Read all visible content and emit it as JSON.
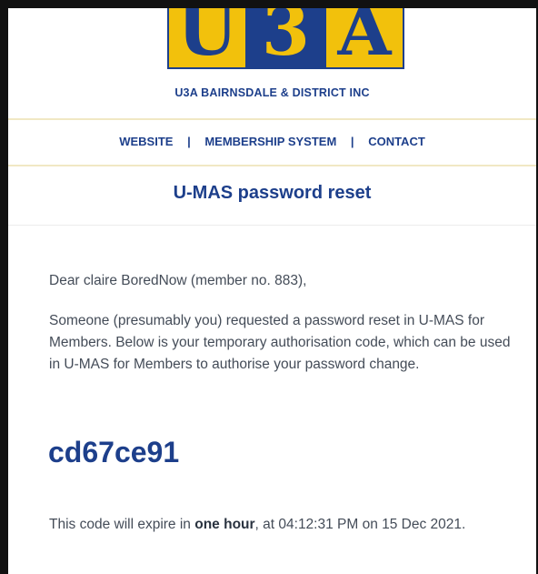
{
  "logo": {
    "letters": [
      "U",
      "3",
      "A"
    ],
    "colors": {
      "yellow": "#f2c10c",
      "navy": "#1d3f8b"
    }
  },
  "header": {
    "org_name": "U3A BAIRNSDALE & DISTRICT INC",
    "nav": {
      "website": "WEBSITE",
      "separator": "|",
      "membership_system": "MEMBERSHIP SYSTEM",
      "contact": "CONTACT"
    }
  },
  "email": {
    "title": "U-MAS password reset",
    "greeting": "Dear claire BoredNow (member no. 883),",
    "body": "Someone (presumably you) requested a password reset in U-MAS for Members. Below is your temporary authorisation code, which can be used in U-MAS for Members to authorise your password change.",
    "code": "cd67ce91",
    "expiry_prefix": "This code will expire in ",
    "expiry_bold": "one hour",
    "expiry_suffix": ", at 04:12:31 PM on 15 Dec 2021."
  }
}
